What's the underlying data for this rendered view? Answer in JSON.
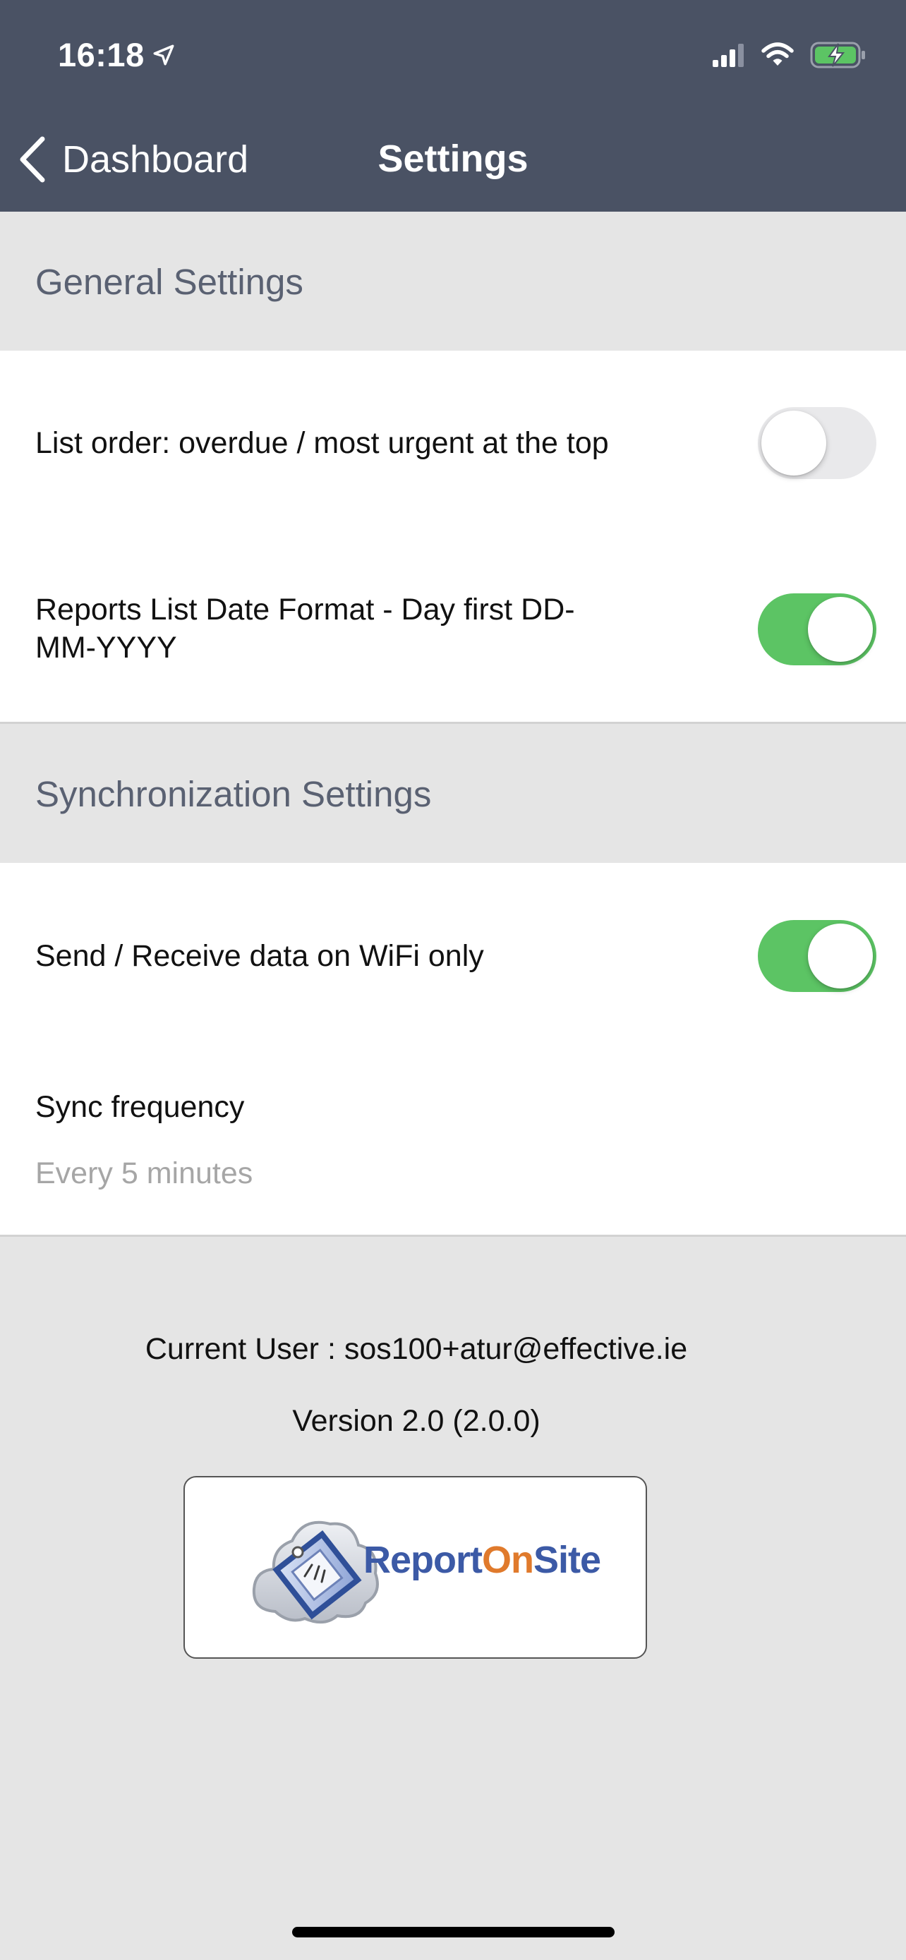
{
  "status_bar": {
    "time": "16:18",
    "icons": [
      "location-arrow-icon",
      "signal-icon",
      "wifi-icon",
      "battery-charging-icon"
    ]
  },
  "nav": {
    "back_label": "Dashboard",
    "title": "Settings"
  },
  "sections": {
    "general": {
      "title": "General Settings",
      "list_order_label": "List order: overdue / most urgent at the top",
      "list_order_on": false,
      "date_format_label_line1": "Reports List Date Format - Day first DD-",
      "date_format_label_line2": "MM-YYYY",
      "date_format_on": true
    },
    "sync": {
      "title": "Synchronization Settings",
      "wifi_only_label": "Send / Receive data on WiFi only",
      "wifi_only_on": true,
      "frequency_label": "Sync frequency",
      "frequency_value": "Every 5 minutes"
    }
  },
  "footer": {
    "current_user": "Current User : sos100+atur@effective.ie",
    "version": "Version 2.0 (2.0.0)",
    "logo": {
      "part1": "Report",
      "part2": "On",
      "part3": "Site"
    }
  },
  "colors": {
    "header_bg": "#4a5264",
    "toggle_on": "#5cc464",
    "toggle_off": "#e9e9eb",
    "section_text": "#5a6172",
    "page_bg": "#e5e5e5"
  }
}
